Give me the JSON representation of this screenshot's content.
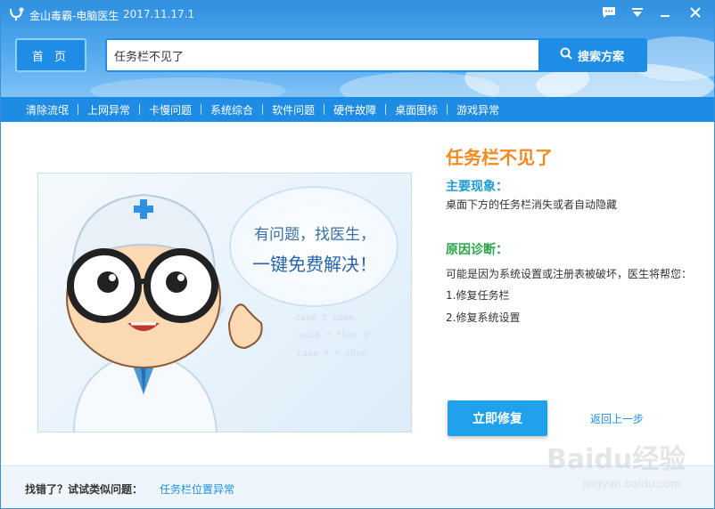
{
  "window": {
    "app_title": "金山毒霸-电脑医生",
    "version": "2017.11.17.1"
  },
  "header": {
    "home_label": "首 页",
    "search_value": "任务栏不见了",
    "search_button_label": "搜索方案"
  },
  "nav": {
    "items": [
      "清除流氓",
      "上网异常",
      "卡慢问题",
      "系统综合",
      "软件问题",
      "硬件故障",
      "桌面图标",
      "游戏异常"
    ]
  },
  "illustration": {
    "bubble_line1": "有问题，找医生，",
    "bubble_line2": "一键免费解决！"
  },
  "problem": {
    "title": "任务栏不见了",
    "symptom_heading": "主要现象：",
    "symptom_text": "桌面下方的任务栏消失或者自动隐藏",
    "diagnosis_heading": "原因诊断：",
    "diagnosis_text": "可能是因为系统设置或注册表被破坏，医生将帮您：",
    "fixes": [
      "1.修复任务栏",
      "2.修复系统设置"
    ]
  },
  "actions": {
    "fix_now_label": "立即修复",
    "back_label": "返回上一步"
  },
  "footer": {
    "label": "找错了？试试类似问题：",
    "related_link": "任务栏位置异常"
  },
  "watermark": {
    "brand": "Baidu经验",
    "url": "jingyan.baidu.com"
  },
  "icons": {
    "app": "doctor-logo-icon",
    "feedback": "chat-bubble-icon",
    "menu": "dropdown-menu-icon",
    "minimize": "minimize-icon",
    "close": "close-icon",
    "search": "search-icon"
  },
  "colors": {
    "accent": "#1e8be5",
    "title_orange": "#f08a24",
    "symptom_blue": "#1d9bd3",
    "diagnosis_green": "#2aa44a"
  }
}
